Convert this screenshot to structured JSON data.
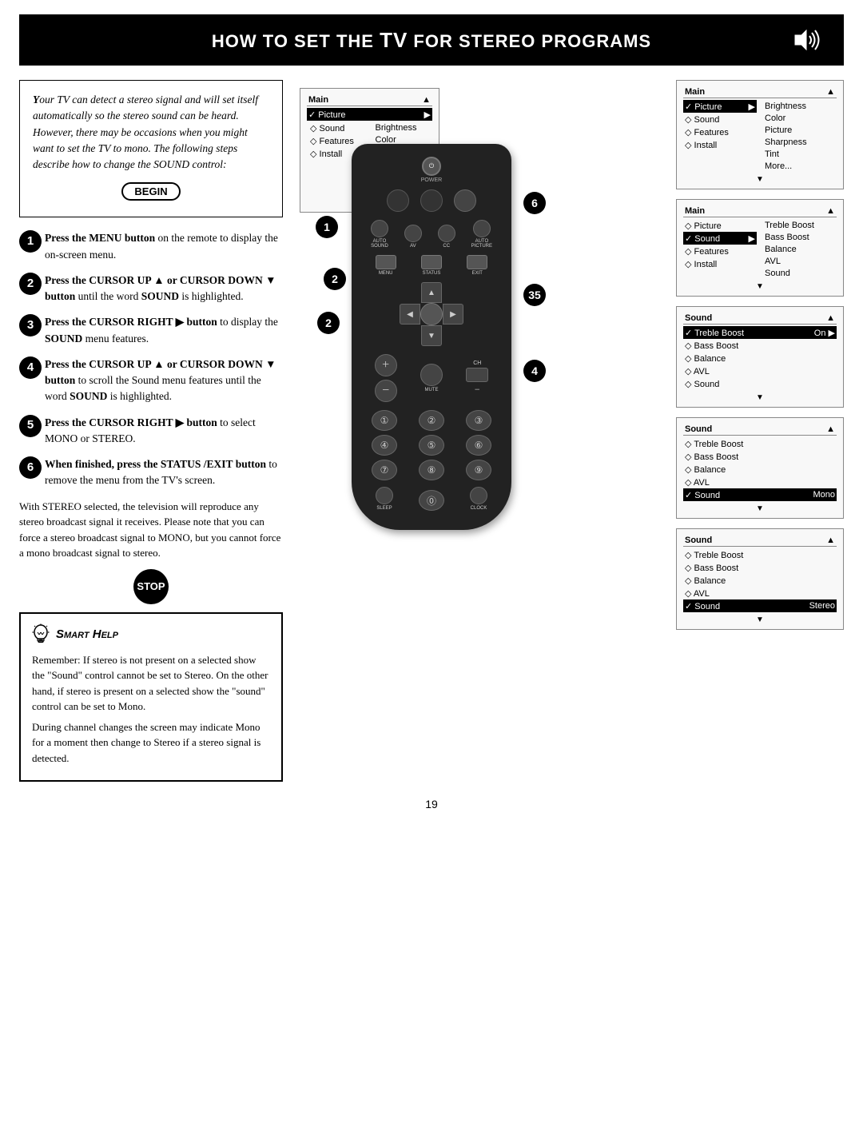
{
  "header": {
    "title_part1": "How to Set the ",
    "title_tv": "TV",
    "title_part2": " for Stereo Programs"
  },
  "intro": {
    "text1": "Your TV can detect a stereo signal and will set itself automatically so the stereo sound can be heard. However, there may be occasions when you might want to set the TV to mono. The following steps describe how to change the SOUND control:",
    "begin_label": "BEGIN"
  },
  "steps": [
    {
      "num": "1",
      "text": "Press the MENU button on the remote to display the on-screen menu."
    },
    {
      "num": "2",
      "text": "Press the CURSOR UP ▲ or CURSOR DOWN ▼ button until the word SOUND is highlighted."
    },
    {
      "num": "3",
      "text": "Press the CURSOR RIGHT ▶ button to display the SOUND menu features."
    },
    {
      "num": "4",
      "text": "Press the CURSOR UP ▲ or CURSOR DOWN ▼ button to scroll the Sound menu features until the word SOUND is highlighted."
    },
    {
      "num": "5",
      "text": "Press the CURSOR RIGHT ▶ button to select MONO or STEREO."
    },
    {
      "num": "6",
      "text": "When finished, press the STATUS/EXIT button to remove the menu from the TV's screen."
    }
  ],
  "stop_label": "STOP",
  "smart_help": {
    "title": "Smart Help",
    "text1": "Remember: If stereo is not present on a selected show the \"Sound\" control cannot be set to Stereo. On the other hand, if stereo is present on a selected show the \"sound\" control can be set to Mono.",
    "text2": "During channel changes the screen may indicate Mono for a moment then change to Stereo if a stereo signal is detected."
  },
  "menu1": {
    "header_left": "Main",
    "header_arrow": "▲",
    "rows": [
      {
        "label": "✓ Picture",
        "value": "▶",
        "col2": "Brightness"
      },
      {
        "label": "◇ Sound",
        "value": "",
        "col2": "Color"
      },
      {
        "label": "◇ Features",
        "value": "",
        "col2": "Picture"
      },
      {
        "label": "◇ Install",
        "value": "",
        "col2": "Sharpness"
      },
      {
        "label": "",
        "value": "",
        "col2": "Tint"
      },
      {
        "label": "",
        "value": "",
        "col2": "More..."
      }
    ],
    "footer_arrow": "▼"
  },
  "menu2": {
    "header_left": "Main",
    "header_arrow": "▲",
    "rows": [
      {
        "label": "◇ Picture",
        "value": "",
        "col2": "Treble Boost"
      },
      {
        "label": "✓ Sound",
        "value": "▶",
        "col2": "Bass Boost",
        "selected": true
      },
      {
        "label": "◇ Features",
        "value": "",
        "col2": "Balance"
      },
      {
        "label": "◇ Install",
        "value": "",
        "col2": "AVL"
      },
      {
        "label": "",
        "value": "",
        "col2": "Sound"
      }
    ],
    "footer_arrow": "▼"
  },
  "menu3": {
    "header_left": "Sound",
    "header_arrow": "▲",
    "rows": [
      {
        "label": "✓ Treble Boost",
        "value": "",
        "col2": "On ▶",
        "selected": true
      },
      {
        "label": "◇ Bass Boost",
        "value": ""
      },
      {
        "label": "◇ Balance",
        "value": ""
      },
      {
        "label": "◇ AVL",
        "value": ""
      },
      {
        "label": "◇ Sound",
        "value": ""
      }
    ],
    "footer_arrow": "▼"
  },
  "menu4": {
    "header_left": "Sound",
    "header_arrow": "▲",
    "rows": [
      {
        "label": "◇ Treble Boost",
        "value": ""
      },
      {
        "label": "◇ Bass Boost",
        "value": ""
      },
      {
        "label": "◇ Balance",
        "value": ""
      },
      {
        "label": "◇ AVL",
        "value": ""
      },
      {
        "label": "✓ Sound",
        "value": "Mono",
        "selected": true
      }
    ],
    "footer_arrow": "▼"
  },
  "menu5": {
    "header_left": "Sound",
    "header_arrow": "▲",
    "rows": [
      {
        "label": "◇ Treble Boost",
        "value": ""
      },
      {
        "label": "◇ Bass Boost",
        "value": ""
      },
      {
        "label": "◇ Balance",
        "value": ""
      },
      {
        "label": "◇ AVL",
        "value": ""
      },
      {
        "label": "✓ Sound",
        "value": "Stereo",
        "selected": true
      }
    ],
    "footer_arrow": "▼"
  },
  "page_number": "19",
  "remote": {
    "power_label": "POWER",
    "buttons": {
      "auto_sound": "AUTO\nSOUND",
      "av": "AV",
      "cc": "CC",
      "auto_picture": "AUTO\nPICTURE",
      "status": "STATUS",
      "menu": "MENU",
      "exit": "EXIT",
      "mute": "MUTE",
      "ch": "CH",
      "sleep": "SLEEP",
      "clock": "CLOCK"
    },
    "numbers": [
      "1",
      "2",
      "3",
      "4",
      "5",
      "6",
      "7",
      "8",
      "9",
      "0"
    ]
  }
}
